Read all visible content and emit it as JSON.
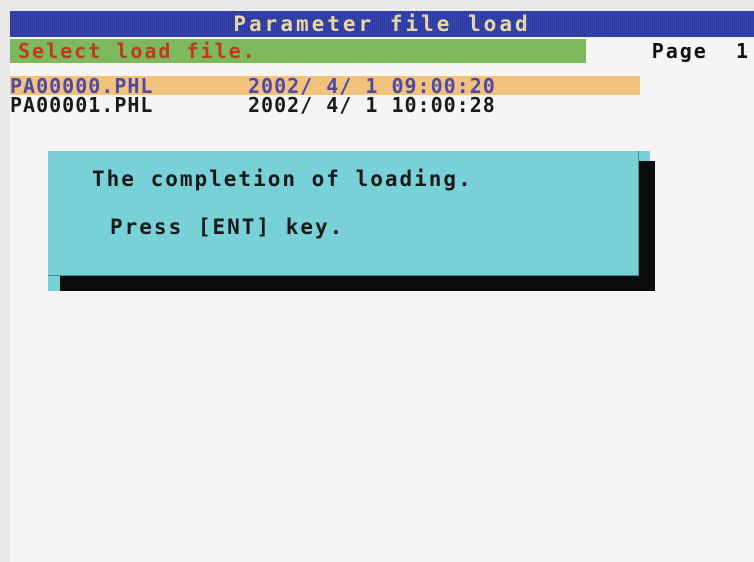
{
  "header": {
    "title": "Parameter file load"
  },
  "status": {
    "message": "Select load file.",
    "page_label": "Page",
    "page_number": "1"
  },
  "files": [
    {
      "name": "PA00000.PHL",
      "date": "2002/ 4/ 1",
      "time": "09:00:20",
      "selected": true
    },
    {
      "name": "PA00001.PHL",
      "date": "2002/ 4/ 1",
      "time": "10:00:28",
      "selected": false
    }
  ],
  "dialog": {
    "line1": "The completion of loading.",
    "line2": "Press [ENT] key."
  },
  "colors": {
    "title_bar": "#2f3fa4",
    "title_text": "#e8d6a6",
    "status_bar": "#7eb85c",
    "status_text": "#bd3a1f",
    "selected_row": "#f1c27c",
    "selected_text": "#4d4aa5",
    "dialog_bg": "#79d1d8",
    "dialog_shadow": "#0b0b0b"
  }
}
